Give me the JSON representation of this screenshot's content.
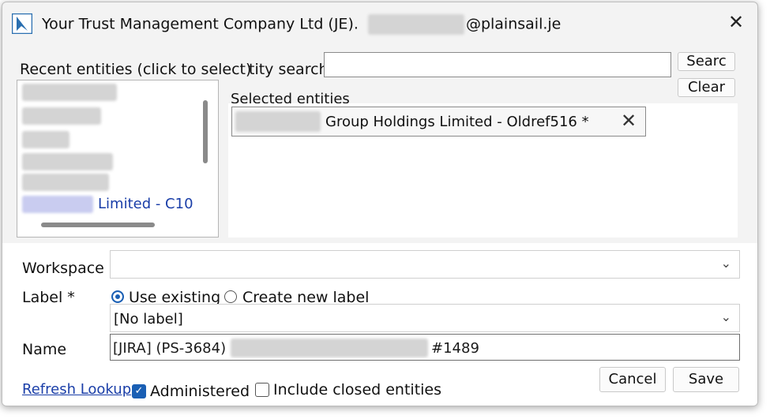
{
  "window": {
    "title_prefix": "Your Trust Management Company Ltd (JE).",
    "title_suffix": "@plainsail.je",
    "close_glyph": "✕"
  },
  "search": {
    "recent_label": "Recent entities (click to select)",
    "search_label": "tity search",
    "search_value": "",
    "search_button": "Searc",
    "clear_button": "Clear"
  },
  "recent": {
    "visible_item": "Limited - C10"
  },
  "selected": {
    "label": "Selected entities",
    "items": [
      {
        "text": "Group Holdings Limited - Oldref516 *",
        "remove_glyph": "✕"
      }
    ]
  },
  "form": {
    "workspace_label": "Workspace",
    "workspace_value": "",
    "label_label": "Label *",
    "radio_use_existing": "Use existing",
    "radio_create_new": "Create new label",
    "label_value": "[No label]",
    "name_label": "Name",
    "name_value_prefix": "[JIRA] (PS-3684)",
    "name_value_suffix": "#1489",
    "chevron_glyph": "⌄"
  },
  "footer": {
    "refresh_link": "Refresh Lookup",
    "administered_label": "Administered",
    "administered_checked": "✓",
    "include_closed_label": "Include closed entities",
    "cancel_button": "Cancel",
    "save_button": "Save"
  },
  "colors": {
    "accent": "#1a5fb4",
    "link": "#1a3ea8"
  }
}
